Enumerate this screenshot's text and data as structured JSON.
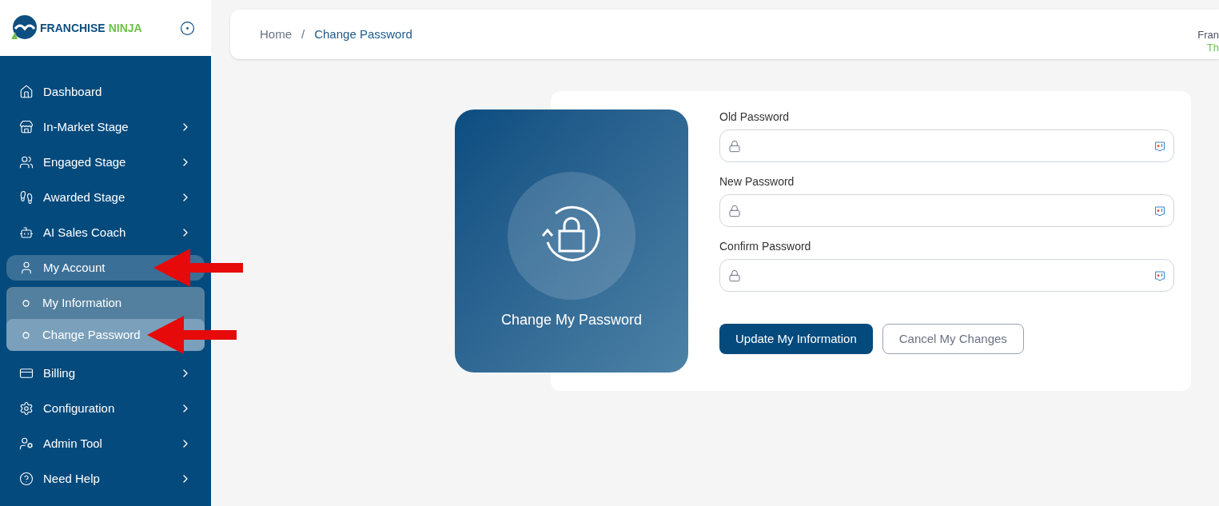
{
  "logo": {
    "word_1": "FRANCHISE",
    "word_2": "NINJA"
  },
  "sidebar": {
    "items": [
      {
        "label": "Dashboard",
        "expandable": false,
        "selected": false
      },
      {
        "label": "In-Market Stage",
        "expandable": true,
        "selected": false
      },
      {
        "label": "Engaged Stage",
        "expandable": true,
        "selected": false
      },
      {
        "label": "Awarded Stage",
        "expandable": true,
        "selected": false
      },
      {
        "label": "AI Sales Coach",
        "expandable": true,
        "selected": false
      },
      {
        "label": "My Account",
        "expandable": false,
        "selected": true,
        "children": [
          {
            "label": "My Information",
            "selected": false
          },
          {
            "label": "Change Password",
            "selected": true
          }
        ]
      },
      {
        "label": "Billing",
        "expandable": true,
        "selected": false
      },
      {
        "label": "Configuration",
        "expandable": true,
        "selected": false
      },
      {
        "label": "Admin Tool",
        "expandable": true,
        "selected": false
      },
      {
        "label": "Need Help",
        "expandable": true,
        "selected": false
      }
    ]
  },
  "breadcrumb": [
    {
      "kind": "link",
      "text": "Home"
    },
    {
      "kind": "separator",
      "text": "/"
    },
    {
      "kind": "current",
      "text": "Change Password"
    }
  ],
  "user": {
    "name": "Fran",
    "company": "Th"
  },
  "panel": {
    "title": "Change My Password"
  },
  "fields": [
    {
      "label": "Old Password"
    },
    {
      "label": "New Password"
    },
    {
      "label": "Confirm Password"
    }
  ],
  "buttons": {
    "primary": "Update My Information",
    "secondary": "Cancel My Changes"
  }
}
